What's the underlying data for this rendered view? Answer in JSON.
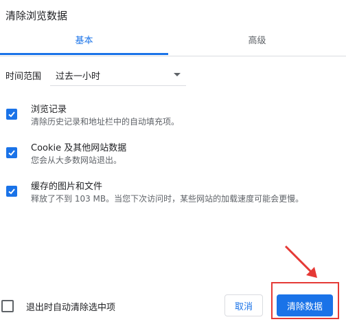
{
  "dialog": {
    "title": "清除浏览数据"
  },
  "tabs": [
    {
      "label": "基本",
      "active": true
    },
    {
      "label": "高级",
      "active": false
    }
  ],
  "time_range": {
    "label": "时间范围",
    "value": "过去一小时"
  },
  "options": [
    {
      "title": "浏览记录",
      "desc": "清除历史记录和地址栏中的自动填充项。",
      "checked": true
    },
    {
      "title": "Cookie 及其他网站数据",
      "desc": "您会从大多数网站退出。",
      "checked": true
    },
    {
      "title": "缓存的图片和文件",
      "desc": "释放了不到 103 MB。当您下次访问时，某些网站的加载速度可能会更慢。",
      "checked": true
    }
  ],
  "footer": {
    "auto_clear_label": "退出时自动清除选中项",
    "auto_clear_checked": false,
    "cancel_label": "取消",
    "clear_label": "清除数据"
  },
  "colors": {
    "accent": "#1a73e8",
    "annotation": "#e53935"
  }
}
